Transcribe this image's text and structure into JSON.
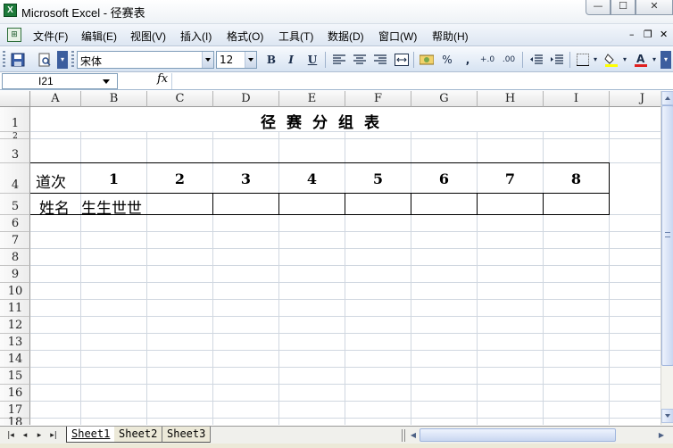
{
  "window": {
    "app_icon": "X",
    "title": "Microsoft Excel - 径赛表",
    "minimize": "—",
    "maximize": "☐",
    "close": "✕"
  },
  "menu": {
    "items": [
      "文件(F)",
      "编辑(E)",
      "视图(V)",
      "插入(I)",
      "格式(O)",
      "工具(T)",
      "数据(D)",
      "窗口(W)",
      "帮助(H)"
    ],
    "doc_minimize": "–",
    "doc_restore": "❐",
    "doc_close": "✕"
  },
  "toolbar": {
    "font_name": "宋体",
    "font_size": "12",
    "bold": "B",
    "italic": "I",
    "underline": "U",
    "percent": "%",
    "comma": ",",
    "increase_decimal": "+.0",
    "decrease_decimal": ".00"
  },
  "formula_bar": {
    "name_box": "I21",
    "fx": "fx",
    "formula": ""
  },
  "grid": {
    "columns": [
      "A",
      "B",
      "C",
      "D",
      "E",
      "F",
      "G",
      "H",
      "I",
      "J"
    ],
    "rows": [
      "1",
      "2",
      "3",
      "4",
      "5",
      "6",
      "7",
      "8",
      "9",
      "10",
      "11",
      "12",
      "13",
      "14",
      "15",
      "16",
      "17",
      "18"
    ],
    "cells": {
      "title": "径赛分组表",
      "a4": "道次",
      "lanes": [
        "1",
        "2",
        "3",
        "4",
        "5",
        "6",
        "7",
        "8"
      ],
      "a5": "姓名",
      "b5": "生生世世"
    }
  },
  "sheets": {
    "tabs": [
      "Sheet1",
      "Sheet2",
      "Sheet3"
    ],
    "active": "Sheet1"
  },
  "colors": {
    "title_bar": "#eef2f6",
    "toolbar": "#d7e3f2",
    "gridline": "#d0d7e0",
    "border": "#000000"
  }
}
